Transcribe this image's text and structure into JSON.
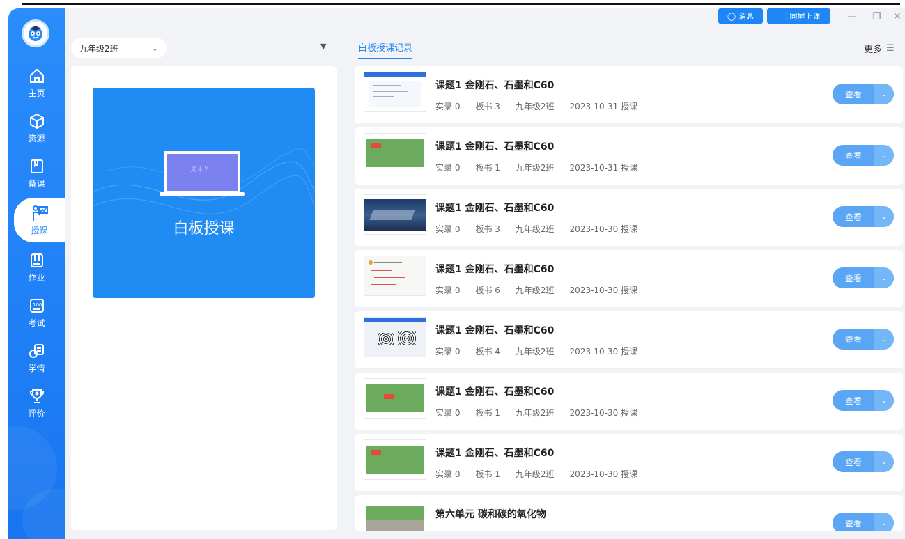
{
  "titlebar": {
    "msg_label": "消息",
    "screen_label": "同屏上课",
    "minimize": "—",
    "restore": "❐",
    "close": "✕"
  },
  "sidebar": {
    "items": [
      {
        "label": "主页",
        "icon": "home-icon"
      },
      {
        "label": "资源",
        "icon": "cube-icon"
      },
      {
        "label": "备课",
        "icon": "book-icon"
      },
      {
        "label": "授课",
        "icon": "teach-icon",
        "active": true
      },
      {
        "label": "作业",
        "icon": "homework-icon"
      },
      {
        "label": "考试",
        "icon": "exam-icon"
      },
      {
        "label": "学情",
        "icon": "stats-icon"
      },
      {
        "label": "评价",
        "icon": "trophy-icon"
      }
    ]
  },
  "left": {
    "class_select": "九年级2班",
    "whiteboard_title": "白板授课",
    "board_text": "X+Y"
  },
  "right": {
    "tab": "白板授课记录",
    "more": "更多",
    "view_label": "查看",
    "records": [
      {
        "title": "课题1 金刚石、石墨和C60",
        "shilu": "实录 0",
        "banshu": "板书 3",
        "cls": "九年级2班",
        "date": "2023-10-31 授课",
        "thumb": "slide"
      },
      {
        "title": "课题1 金刚石、石墨和C60",
        "shilu": "实录 0",
        "banshu": "板书 1",
        "cls": "九年级2班",
        "date": "2023-10-31 授课",
        "thumb": "green"
      },
      {
        "title": "课题1 金刚石、石墨和C60",
        "shilu": "实录 0",
        "banshu": "板书 3",
        "cls": "九年级2班",
        "date": "2023-10-30 授课",
        "thumb": "photo"
      },
      {
        "title": "课题1 金刚石、石墨和C60",
        "shilu": "实录 0",
        "banshu": "板书 6",
        "cls": "九年级2班",
        "date": "2023-10-30 授课",
        "thumb": "note"
      },
      {
        "title": "课题1 金刚石、石墨和C60",
        "shilu": "实录 0",
        "banshu": "板书 4",
        "cls": "九年级2班",
        "date": "2023-10-30 授课",
        "thumb": "molecule"
      },
      {
        "title": "课题1 金刚石、石墨和C60",
        "shilu": "实录 0",
        "banshu": "板书 1",
        "cls": "九年级2班",
        "date": "2023-10-30 授课",
        "thumb": "green"
      },
      {
        "title": "课题1 金刚石、石墨和C60",
        "shilu": "实录 0",
        "banshu": "板书 1",
        "cls": "九年级2班",
        "date": "2023-10-30 授课",
        "thumb": "green"
      },
      {
        "title": "第六单元 碳和碳的氧化物",
        "shilu": "",
        "banshu": "",
        "cls": "",
        "date": "",
        "thumb": "board"
      }
    ]
  },
  "colors": {
    "primary": "#1e86f5",
    "sidebar": "#1f80f7",
    "card": "#1f8bf3",
    "bg": "#f2f3f7",
    "view_btn": "#5aa6f4"
  }
}
